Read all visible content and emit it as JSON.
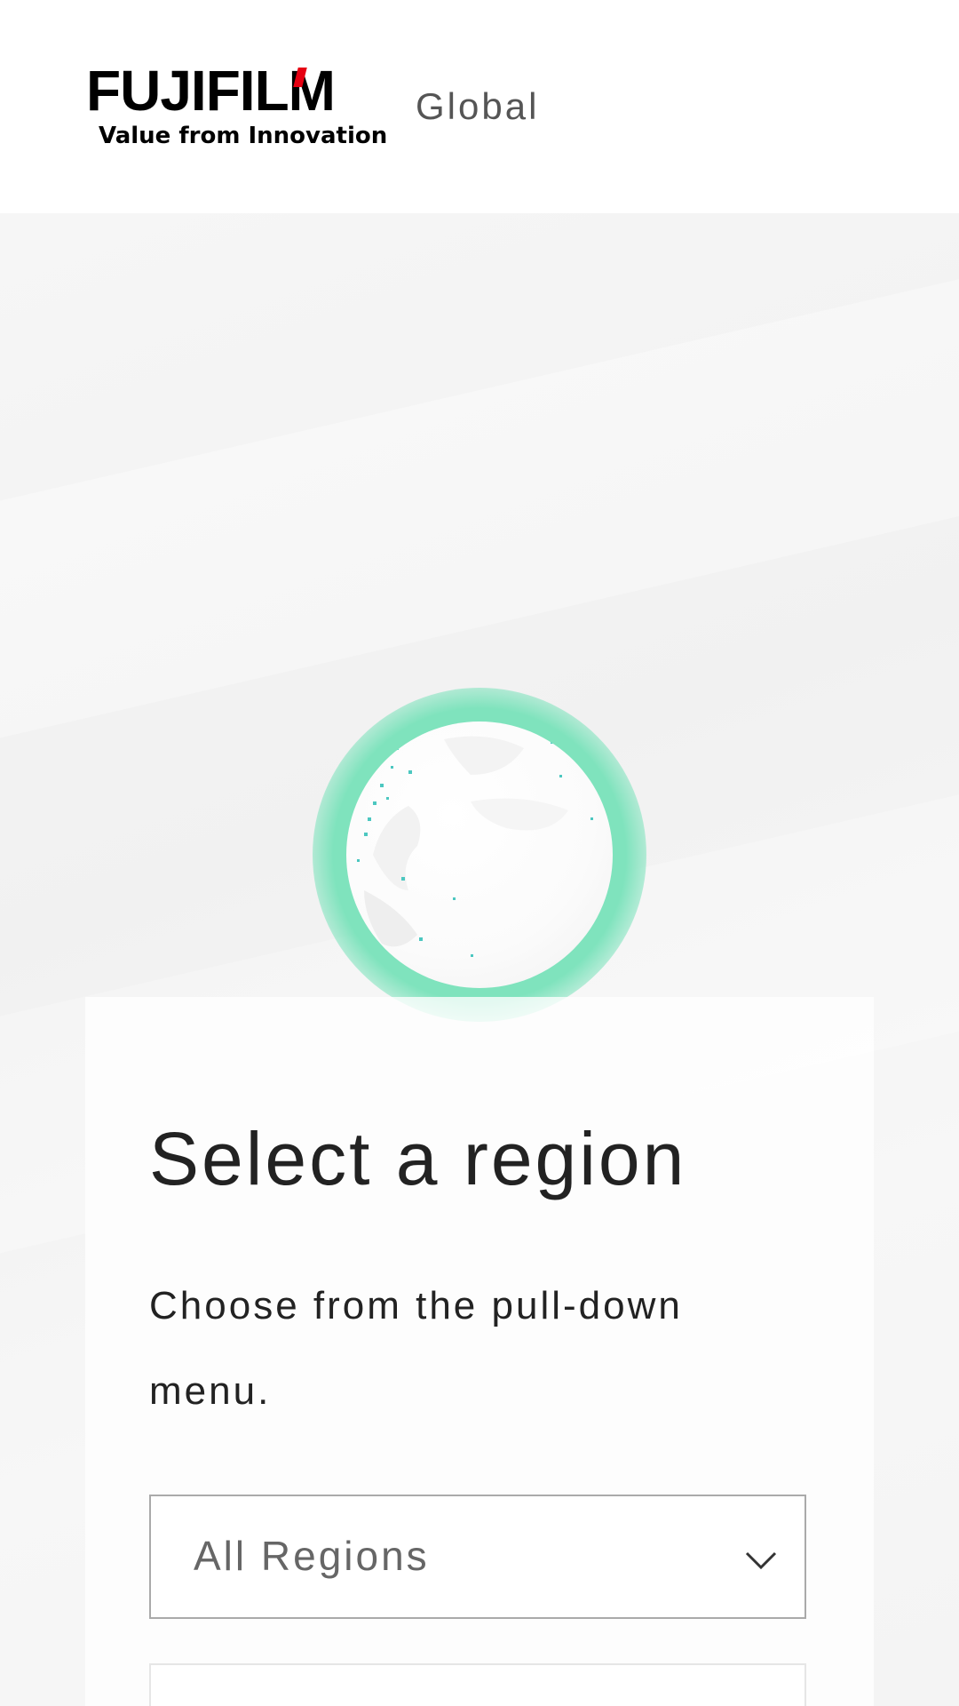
{
  "header": {
    "logo": {
      "wordmark": "FUJIFILM",
      "tagline": "Value from Innovation"
    },
    "site_label": "Global"
  },
  "colors": {
    "brand_red": "#e60012",
    "globe_glow": "#7fe3bd",
    "text": "#222222"
  },
  "icons": {
    "globe": "globe-icon",
    "dropdown": "chevron-down-icon"
  },
  "region_selector": {
    "title": "Select a region",
    "description": "Choose from the pull-down menu.",
    "dropdown": {
      "selected": "All Regions"
    }
  }
}
